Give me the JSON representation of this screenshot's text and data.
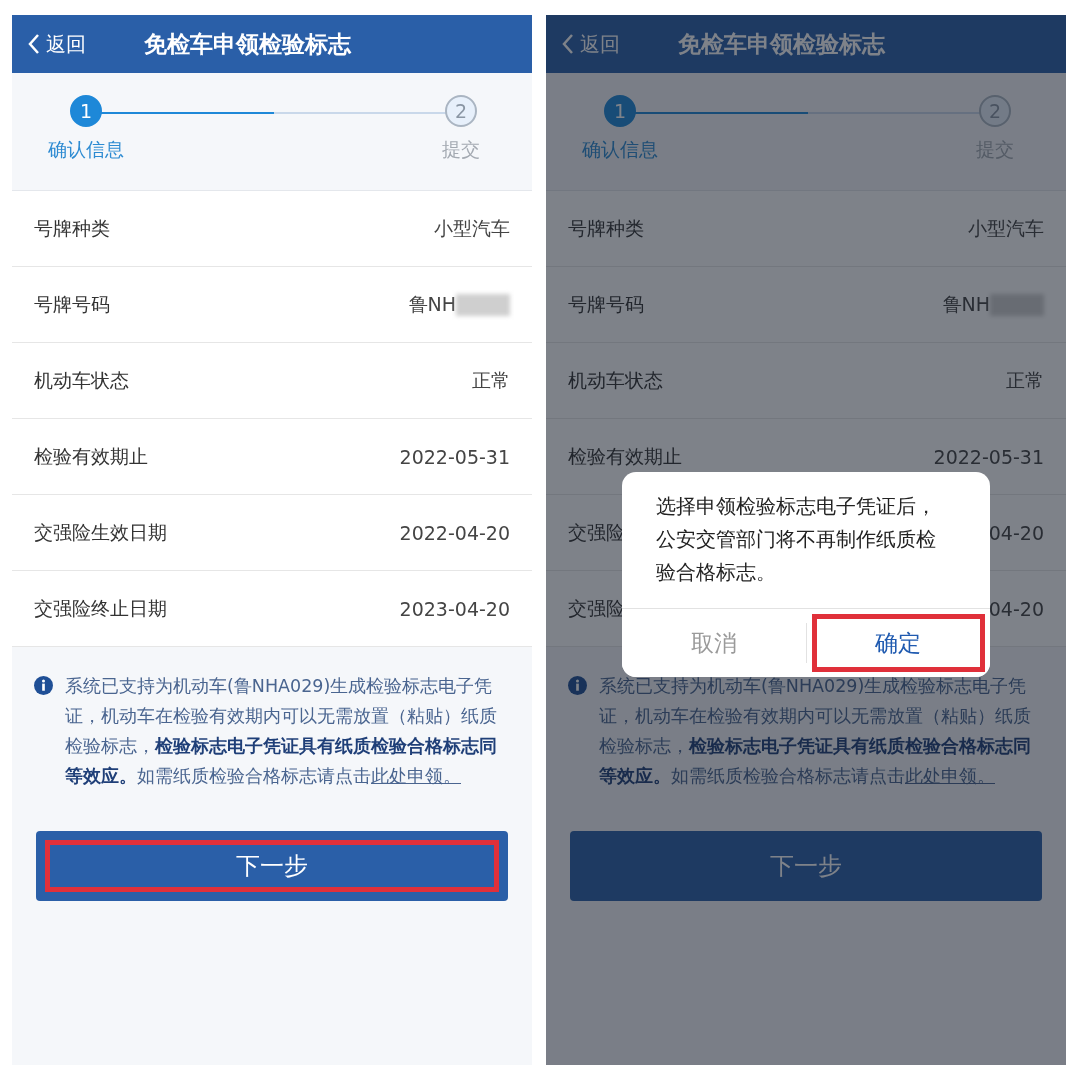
{
  "screens": [
    {
      "header": {
        "back": "返回",
        "title": "免检车申领检验标志"
      },
      "steps": [
        {
          "number": "1",
          "label": "确认信息",
          "selected": true
        },
        {
          "number": "2",
          "label": "提交",
          "selected": false
        }
      ],
      "fields": [
        {
          "label": "号牌种类",
          "value": "小型汽车"
        },
        {
          "label": "号牌号码",
          "value": "鲁NH",
          "masked": true
        },
        {
          "label": "机动车状态",
          "value": "正常"
        },
        {
          "label": "检验有效期止",
          "value": "2022-05-31"
        },
        {
          "label": "交强险生效日期",
          "value": "2022-04-20"
        },
        {
          "label": "交强险终止日期",
          "value": "2023-04-20"
        }
      ],
      "notice": {
        "text": "系统已支持为机动车(鲁NHA029)生成检验标志电子凭证，机动车在检验有效期内可以无需放置（粘贴）纸质检验标志，**检验标志电子凭证具有纸质检验合格标志同等效应。**如需纸质检验合格标志请点击",
        "link": "此处申领。"
      },
      "next_button": {
        "label": "下一步",
        "highlighted": true
      }
    },
    {
      "header": {
        "back": "返回",
        "title": "免检车申领检验标志"
      },
      "steps": [
        {
          "number": "1",
          "label": "确认信息",
          "selected": true
        },
        {
          "number": "2",
          "label": "提交",
          "selected": false
        }
      ],
      "fields": [
        {
          "label": "号牌种类",
          "value": "小型汽车"
        },
        {
          "label": "号牌号码",
          "value": "鲁NH",
          "masked": true
        },
        {
          "label": "机动车状态",
          "value": "正常"
        },
        {
          "label": "检验有效期止",
          "value": "2022-05-31"
        },
        {
          "label": "交强险",
          "value": "04-20"
        },
        {
          "label": "交强险",
          "value": "04-20"
        }
      ],
      "notice": {
        "text": "系统已支持为机动车(鲁NHA029)生成检验标志电子凭证，机动车在检验有效期内可以无需放置（粘贴）纸质检验标志，**检验标志电子凭证具有纸质检验合格标志同等效应。**如需纸质检验合格标志请点击",
        "link": "此处申领。"
      },
      "next_button": {
        "label": "下一步",
        "highlighted": false
      },
      "dialog": {
        "message": "选择申领检验标志电子凭证后，公安交管部门将不再制作纸质检验合格标志。",
        "cancel": {
          "label": "取消",
          "highlighted": false
        },
        "confirm": {
          "label": "确定",
          "highlighted": true
        }
      }
    }
  ]
}
